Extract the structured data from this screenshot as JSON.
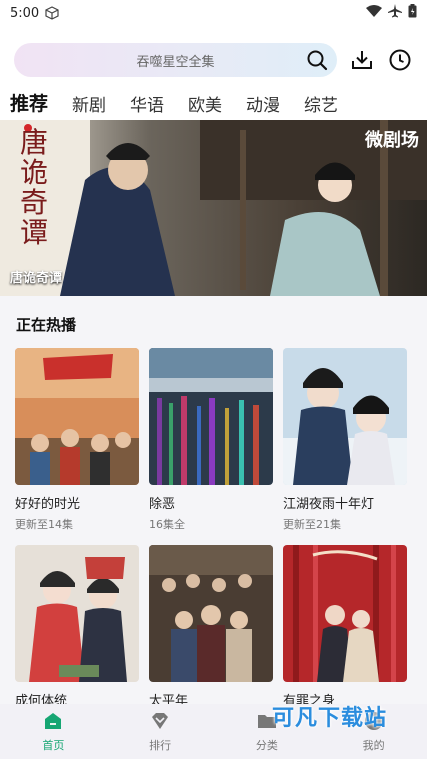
{
  "status_bar": {
    "time": "5:00"
  },
  "search": {
    "placeholder": "吞噬星空全集"
  },
  "tabs": [
    {
      "label": "推荐"
    },
    {
      "label": "新剧"
    },
    {
      "label": "华语"
    },
    {
      "label": "欧美"
    },
    {
      "label": "动漫"
    },
    {
      "label": "综艺"
    }
  ],
  "banner": {
    "caption": "唐诡奇谭",
    "brand": "微剧场",
    "title_art": "唐诡奇谭"
  },
  "hot_section": {
    "title": "正在热播",
    "items": [
      {
        "name": "好好的时光",
        "sub": "更新至14集"
      },
      {
        "name": "除恶",
        "sub": "16集全"
      },
      {
        "name": "江湖夜雨十年灯",
        "sub": "更新至21集"
      },
      {
        "name": "成何体统",
        "sub": ""
      },
      {
        "name": "太平年",
        "sub": ""
      },
      {
        "name": "有罪之身",
        "sub": ""
      }
    ]
  },
  "bottom_nav": [
    {
      "label": "首页"
    },
    {
      "label": "排行"
    },
    {
      "label": "分类"
    },
    {
      "label": "我的"
    }
  ],
  "watermark": "可凡下载站",
  "colors": {
    "accent": "#16a673"
  }
}
